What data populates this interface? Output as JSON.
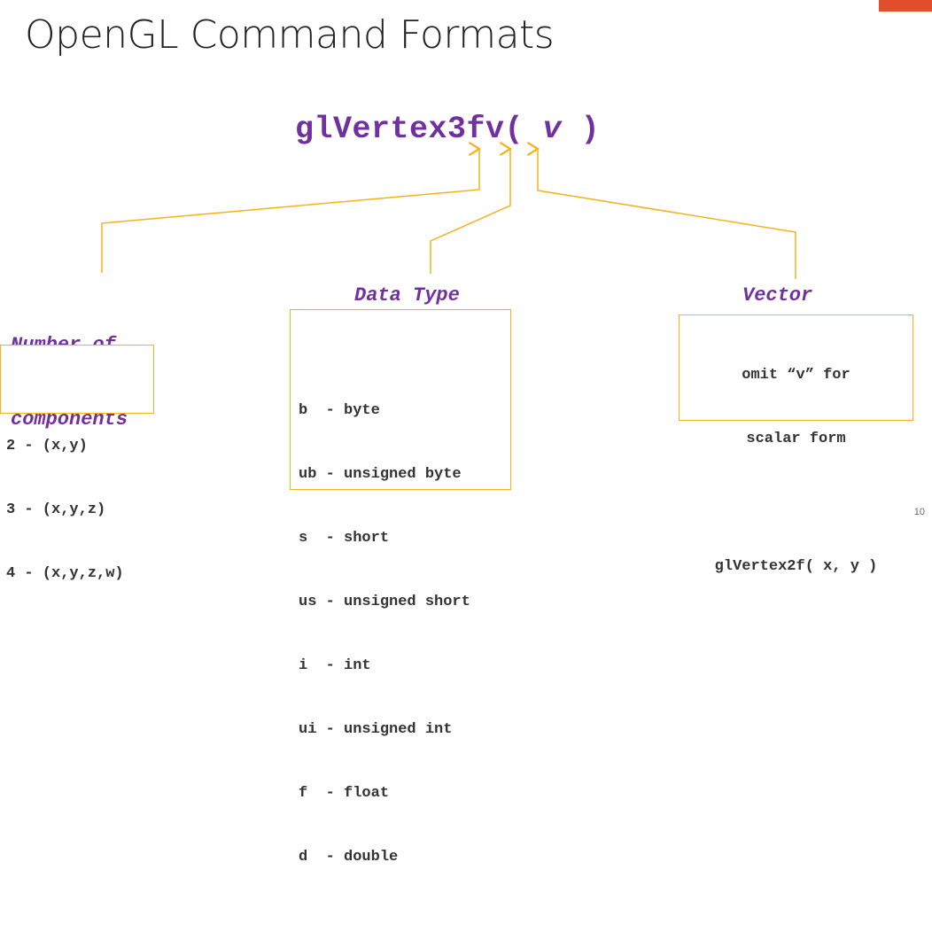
{
  "title": "OpenGL Command Formats",
  "colors": {
    "accent": "#e24e2b",
    "purple": "#7030a0",
    "orange": "#f5b21a"
  },
  "command": {
    "name": "glVertex3fv(",
    "arg": "v",
    "close": " )"
  },
  "components": {
    "label_line1": "Number of",
    "label_line2": "components",
    "items": [
      "2 - (x,y)",
      "3 - (x,y,z)",
      "4 - (x,y,z,w)"
    ]
  },
  "data_type": {
    "label": "Data Type",
    "items": [
      "b  - byte",
      "ub - unsigned byte",
      "s  - short",
      "us - unsigned short",
      "i  - int",
      "ui - unsigned int",
      "f  - float",
      "d  - double"
    ]
  },
  "vector": {
    "label": "Vector",
    "line1": "omit “v” for",
    "line2": "scalar form",
    "example": "glVertex2f( x, y )"
  },
  "page_number": "10"
}
